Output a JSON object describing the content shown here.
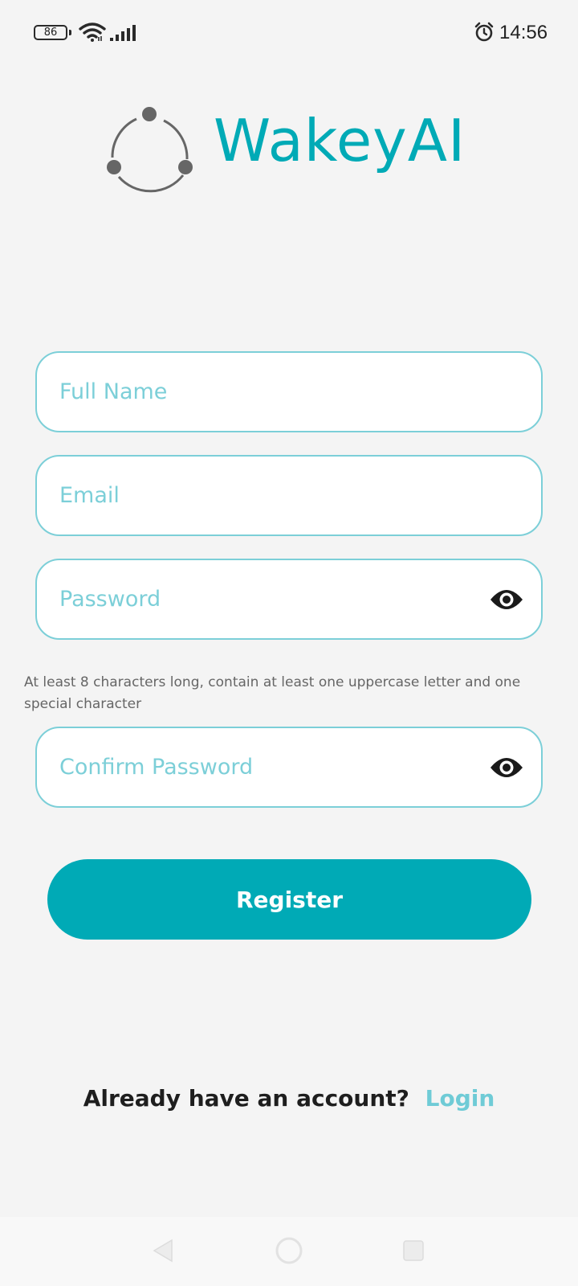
{
  "status_bar": {
    "battery": "86",
    "time": "14:56",
    "icons": [
      "battery-icon",
      "wifi-icon",
      "signal-icon",
      "alarm-icon"
    ]
  },
  "brand": {
    "name": "WakeyAI",
    "color": "#00aab6"
  },
  "form": {
    "full_name": {
      "placeholder": "Full Name",
      "value": ""
    },
    "email": {
      "placeholder": "Email",
      "value": ""
    },
    "password": {
      "placeholder": "Password",
      "value": "",
      "toggle_icon": "eye-icon"
    },
    "password_hint": "At least 8 characters long, contain at least one uppercase letter and one special character",
    "confirm_password": {
      "placeholder": "Confirm Password",
      "value": "",
      "toggle_icon": "eye-icon"
    },
    "register_label": "Register"
  },
  "footer": {
    "prompt": "Already have an account?",
    "login_label": "Login"
  },
  "nav_bar": {
    "icons": [
      "back-icon",
      "home-icon",
      "recents-icon"
    ]
  },
  "colors": {
    "accent": "#00aab6",
    "field_border": "#7ccfd8",
    "background": "#f4f4f4"
  }
}
